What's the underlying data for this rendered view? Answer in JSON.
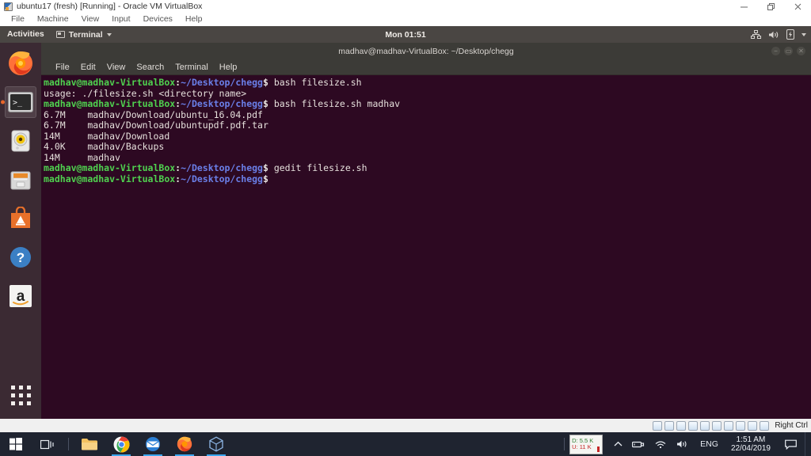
{
  "host": {
    "window_title": "ubuntu17 (fresh) [Running] - Oracle VM VirtualBox",
    "menu": [
      "File",
      "Machine",
      "View",
      "Input",
      "Devices",
      "Help"
    ],
    "window_controls": [
      "minimize",
      "restore",
      "close"
    ],
    "status_bar": {
      "icons": [
        "hard-disk-icon",
        "optical-disk-icon",
        "network-icon",
        "shared-folder-icon",
        "display-icon",
        "usb-icon",
        "video-capture-icon",
        "mouse-capture-icon",
        "keyboard-icon",
        "host-key-icon"
      ],
      "host_key_label": "Right Ctrl"
    }
  },
  "guest": {
    "panel": {
      "activities": "Activities",
      "app_menu": "Terminal",
      "clock": "Mon 01:51",
      "tray_icons": [
        "network-icon",
        "volume-icon",
        "battery-icon",
        "chevron-down-icon"
      ]
    },
    "launcher": {
      "items": [
        {
          "name": "firefox",
          "label": "Firefox",
          "active": false
        },
        {
          "name": "terminal",
          "label": "Terminal",
          "active": true
        },
        {
          "name": "rhythmbox",
          "label": "Rhythmbox",
          "active": false
        },
        {
          "name": "files",
          "label": "Files",
          "active": false
        },
        {
          "name": "ubuntu-software",
          "label": "Ubuntu Software",
          "active": false
        },
        {
          "name": "help",
          "label": "Help",
          "active": false
        },
        {
          "name": "amazon",
          "label": "Amazon",
          "active": false
        }
      ],
      "show_applications": "Show Applications"
    },
    "terminal": {
      "title": "madhav@madhav-VirtualBox: ~/Desktop/chegg",
      "window_buttons": [
        "minimize",
        "maximize",
        "close"
      ],
      "menu": [
        "File",
        "Edit",
        "View",
        "Search",
        "Terminal",
        "Help"
      ],
      "prompt": {
        "user_host": "madhav@madhav-VirtualBox",
        "separator": ":",
        "path": "~/Desktop/chegg",
        "symbol": "$"
      },
      "colors": {
        "background": "#2d0922",
        "user_host": "#4fd14f",
        "path": "#6a7fe8",
        "output": "#e6e0dc"
      },
      "lines": [
        {
          "type": "prompt",
          "command": " bash filesize.sh"
        },
        {
          "type": "output",
          "text": "usage: ./filesize.sh <directory name>"
        },
        {
          "type": "prompt",
          "command": " bash filesize.sh madhav"
        },
        {
          "type": "output",
          "text": "6.7M    madhav/Download/ubuntu_16.04.pdf"
        },
        {
          "type": "output",
          "text": "6.7M    madhav/Download/ubuntupdf.pdf.tar"
        },
        {
          "type": "output",
          "text": "14M     madhav/Download"
        },
        {
          "type": "output",
          "text": "4.0K    madhav/Backups"
        },
        {
          "type": "output",
          "text": "14M     madhav"
        },
        {
          "type": "prompt",
          "command": " gedit filesize.sh"
        },
        {
          "type": "prompt",
          "command": ""
        }
      ]
    }
  },
  "taskbar": {
    "items": [
      {
        "name": "start-button",
        "label": "Start",
        "running": false
      },
      {
        "name": "task-view-button",
        "label": "Task View",
        "running": false
      },
      {
        "name": "file-explorer",
        "label": "File Explorer",
        "running": false
      },
      {
        "name": "google-chrome",
        "label": "Google Chrome",
        "running": true
      },
      {
        "name": "mail",
        "label": "Mail",
        "running": true
      },
      {
        "name": "firefox",
        "label": "Firefox",
        "running": true
      },
      {
        "name": "virtualbox",
        "label": "Oracle VM VirtualBox",
        "running": true
      }
    ],
    "tray": {
      "network_meter": {
        "down": "D: 5.5 K",
        "up": "U: 11 K"
      },
      "icons": [
        "chevron-up-icon",
        "removable-media-icon",
        "wifi-icon",
        "volume-icon"
      ],
      "language": "ENG",
      "clock_time": "1:51 AM",
      "clock_date": "22/04/2019",
      "notification": "notification-icon"
    }
  }
}
